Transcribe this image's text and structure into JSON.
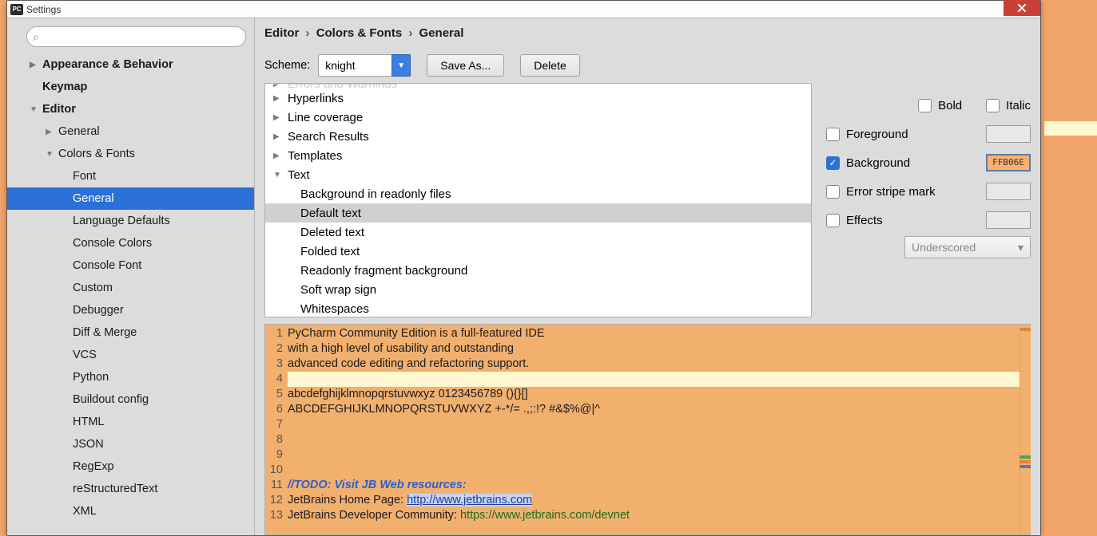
{
  "window": {
    "title": "Settings",
    "app_icon_label": "PC"
  },
  "search": {
    "placeholder": ""
  },
  "sidebar": {
    "items": [
      {
        "label": "Appearance & Behavior",
        "level": 1,
        "bold": true,
        "tri": "closed"
      },
      {
        "label": "Keymap",
        "level": 1,
        "bold": true,
        "tri": "none"
      },
      {
        "label": "Editor",
        "level": 1,
        "bold": true,
        "tri": "open"
      },
      {
        "label": "General",
        "level": 2,
        "tri": "closed"
      },
      {
        "label": "Colors & Fonts",
        "level": 2,
        "tri": "open"
      },
      {
        "label": "Font",
        "level": 3,
        "tri": "none"
      },
      {
        "label": "General",
        "level": 3,
        "tri": "none",
        "selected": true
      },
      {
        "label": "Language Defaults",
        "level": 3,
        "tri": "none"
      },
      {
        "label": "Console Colors",
        "level": 3,
        "tri": "none"
      },
      {
        "label": "Console Font",
        "level": 3,
        "tri": "none"
      },
      {
        "label": "Custom",
        "level": 3,
        "tri": "none"
      },
      {
        "label": "Debugger",
        "level": 3,
        "tri": "none"
      },
      {
        "label": "Diff & Merge",
        "level": 3,
        "tri": "none"
      },
      {
        "label": "VCS",
        "level": 3,
        "tri": "none"
      },
      {
        "label": "Python",
        "level": 3,
        "tri": "none"
      },
      {
        "label": "Buildout config",
        "level": 3,
        "tri": "none"
      },
      {
        "label": "HTML",
        "level": 3,
        "tri": "none"
      },
      {
        "label": "JSON",
        "level": 3,
        "tri": "none"
      },
      {
        "label": "RegExp",
        "level": 3,
        "tri": "none"
      },
      {
        "label": "reStructuredText",
        "level": 3,
        "tri": "none"
      },
      {
        "label": "XML",
        "level": 3,
        "tri": "none"
      }
    ]
  },
  "breadcrumb": {
    "a": "Editor",
    "b": "Colors & Fonts",
    "c": "General"
  },
  "scheme": {
    "label": "Scheme:",
    "value": "knight",
    "save_as": "Save As...",
    "delete": "Delete"
  },
  "categories": [
    {
      "label": "Errors and Warnings",
      "tri": "closed",
      "cut": true
    },
    {
      "label": "Hyperlinks",
      "tri": "closed"
    },
    {
      "label": "Line coverage",
      "tri": "closed"
    },
    {
      "label": "Search Results",
      "tri": "closed"
    },
    {
      "label": "Templates",
      "tri": "closed"
    },
    {
      "label": "Text",
      "tri": "open"
    },
    {
      "label": "Background in readonly files",
      "sub": true
    },
    {
      "label": "Default text",
      "sub": true,
      "selected": true
    },
    {
      "label": "Deleted text",
      "sub": true
    },
    {
      "label": "Folded text",
      "sub": true
    },
    {
      "label": "Readonly fragment background",
      "sub": true
    },
    {
      "label": "Soft wrap sign",
      "sub": true
    },
    {
      "label": "Whitespaces",
      "sub": true
    }
  ],
  "options": {
    "bold": "Bold",
    "italic": "Italic",
    "foreground": "Foreground",
    "background": "Background",
    "background_value": "FFB06E",
    "error_stripe": "Error stripe mark",
    "effects": "Effects",
    "effects_type": "Underscored"
  },
  "preview": {
    "lines": [
      "PyCharm Community Edition is a full-featured IDE",
      "with a high level of usability and outstanding",
      "advanced code editing and refactoring support.",
      "",
      "abcdefghijklmnopqrstuvwxyz 0123456789 (){}[]",
      "ABCDEFGHIJKLMNOPQRSTUVWXYZ +-*/= .,;:!? #&$%@|^",
      "",
      "",
      "",
      "",
      "//TODO: Visit JB Web resources:",
      "JetBrains Home Page: http://www.jetbrains.com",
      "JetBrains Developer Community: https://www.jetbrains.com/devnet"
    ],
    "todo_prefix": "//TODO: Visit JB Web resources:",
    "link1_label": "JetBrains Home Page: ",
    "link1_url": "http://www.jetbrains.com",
    "link2_label": "JetBrains Developer Community: ",
    "link2_url": "https://www.jetbrains.com/devnet"
  }
}
